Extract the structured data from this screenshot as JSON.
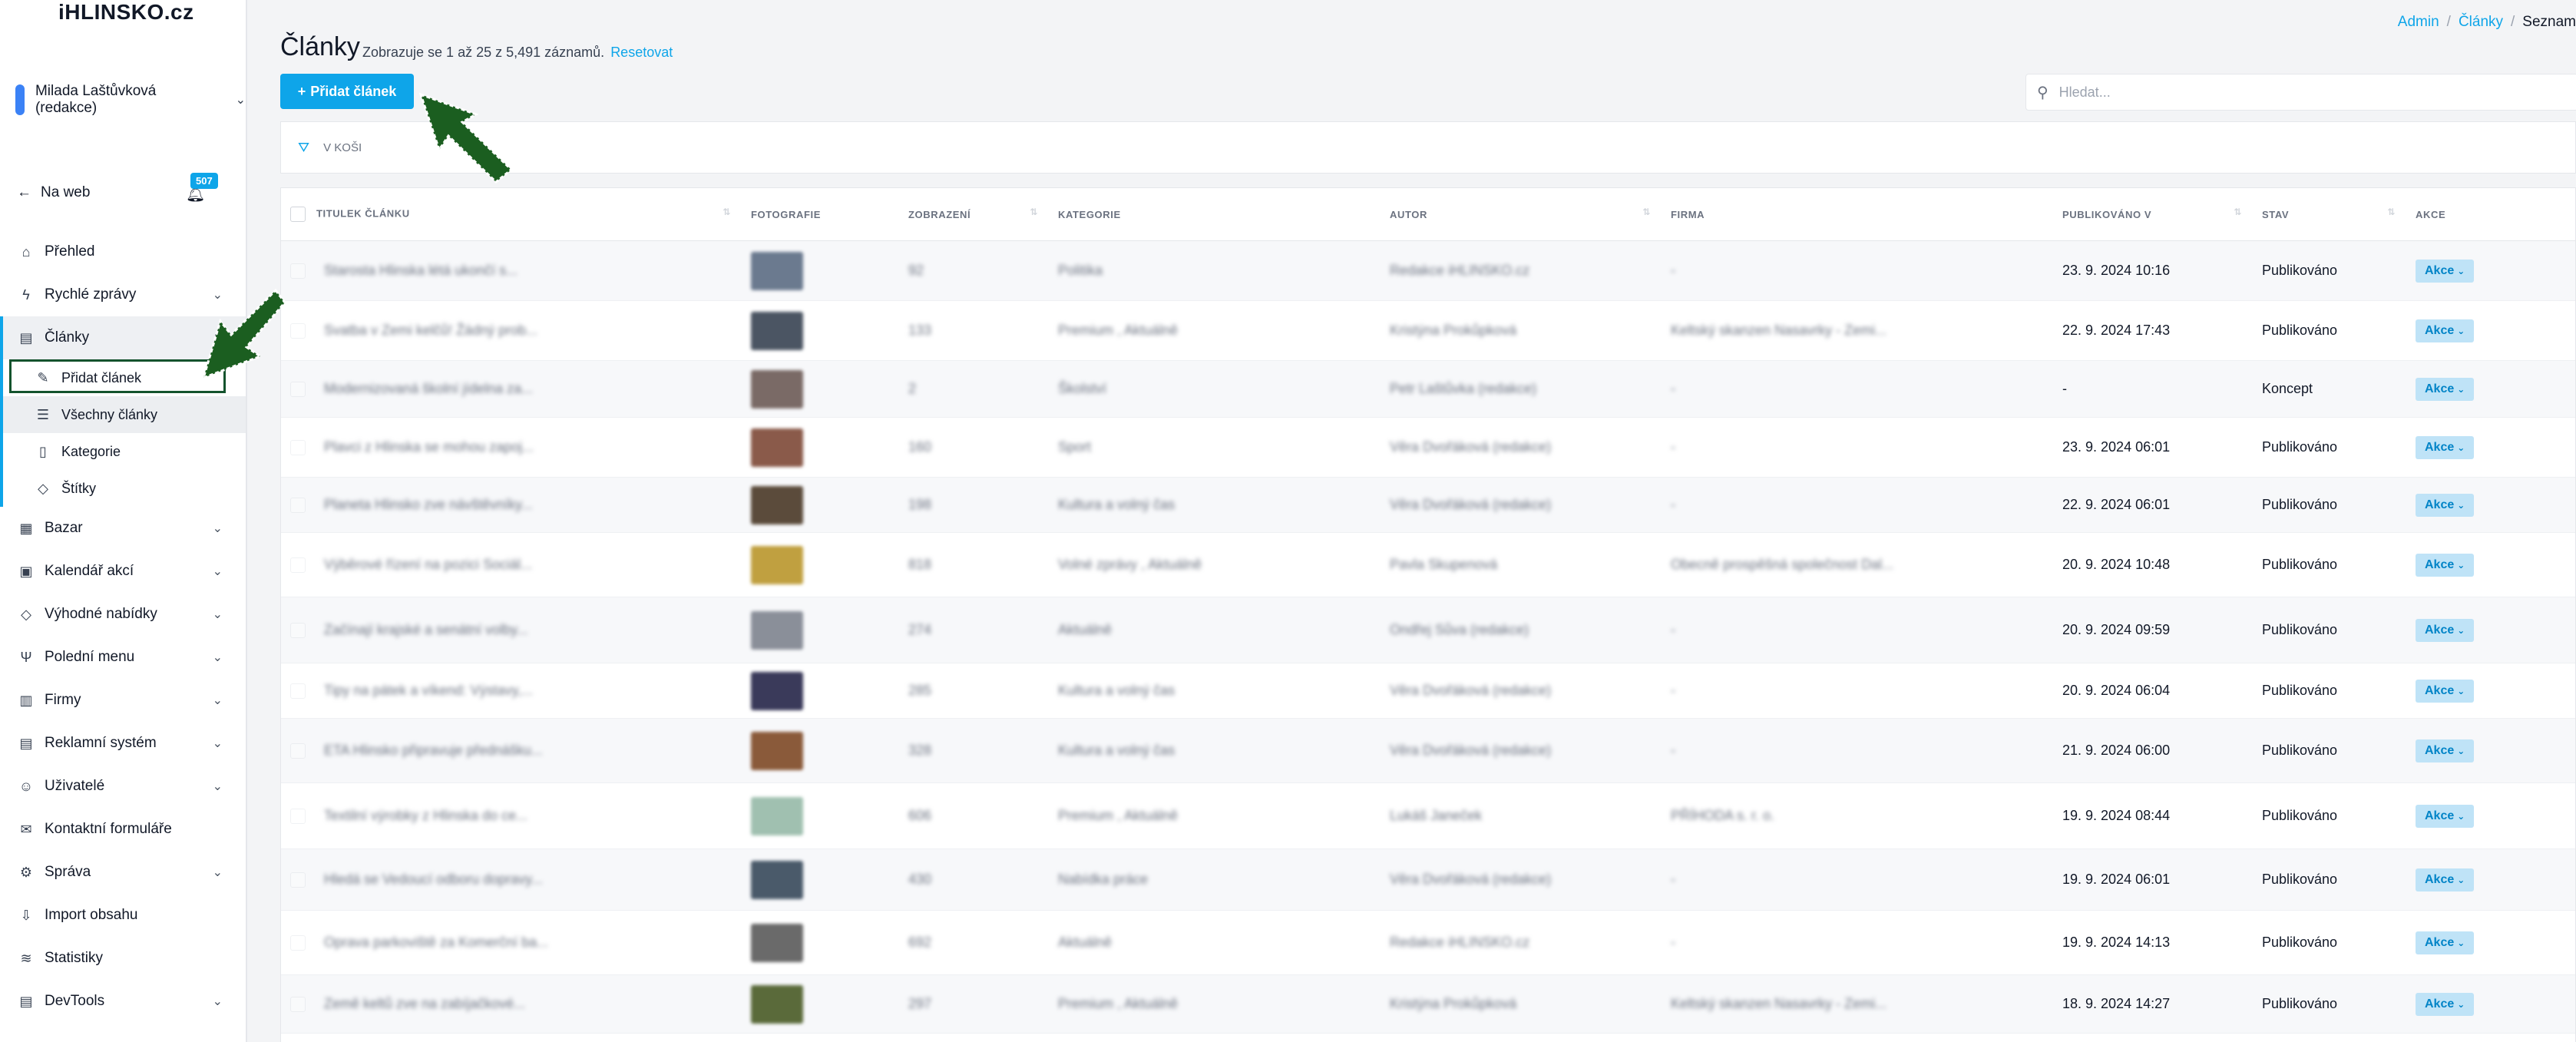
{
  "sidebar": {
    "logo": "iHLINSKO.cz",
    "user_name": "Milada Laštůvková (redakce)",
    "back_label": "Na web",
    "notifications_count": "507",
    "items": [
      {
        "label": "Přehled",
        "icon": "home-icon"
      },
      {
        "label": "Rychlé zprávy",
        "icon": "bolt-icon"
      },
      {
        "label": "Články",
        "icon": "newspaper-icon"
      },
      {
        "label": "Bazar",
        "icon": "store-icon"
      },
      {
        "label": "Kalendář akcí",
        "icon": "calendar-icon"
      },
      {
        "label": "Výhodné nabídky",
        "icon": "tag-icon"
      },
      {
        "label": "Polední menu",
        "icon": "utensils-icon"
      },
      {
        "label": "Firmy",
        "icon": "building-icon"
      },
      {
        "label": "Reklamní systém",
        "icon": "ad-icon"
      },
      {
        "label": "Uživatelé",
        "icon": "user-icon"
      },
      {
        "label": "Kontaktní formuláře",
        "icon": "mail-icon"
      },
      {
        "label": "Správa",
        "icon": "gear-icon"
      },
      {
        "label": "Import obsahu",
        "icon": "import-icon"
      },
      {
        "label": "Statistiky",
        "icon": "chart-icon"
      },
      {
        "label": "DevTools",
        "icon": "tools-icon"
      }
    ],
    "subitems": [
      {
        "label": "Přidat článek",
        "icon": "edit-icon"
      },
      {
        "label": "Všechny články",
        "icon": "list-icon"
      },
      {
        "label": "Kategorie",
        "icon": "bookmark-icon"
      },
      {
        "label": "Štítky",
        "icon": "tag-icon"
      }
    ]
  },
  "breadcrumb": [
    "Admin",
    "Články",
    "Seznam"
  ],
  "page": {
    "title": "Články",
    "info": "Zobrazuje se 1 až 25 z 5,491 záznamů.",
    "reset": "Resetovat",
    "add_button": "Přidat článek",
    "search_placeholder": "Hledat...",
    "filter_label": "V KOŠI"
  },
  "table": {
    "columns": [
      "TITULEK ČLÁNKU",
      "FOTOGRAFIE",
      "ZOBRAZENÍ",
      "KATEGORIE",
      "AUTOR",
      "FIRMA",
      "PUBLIKOVÁNO V",
      "STAV",
      "AKCE"
    ],
    "action_label": "Akce",
    "rows": [
      {
        "title": "Starosta Hlinska létá ukončí s...",
        "views": "92",
        "category": "Politika",
        "author": "Redakce iHLINSKO.cz",
        "company": "-",
        "published": "23. 9. 2024 10:16",
        "status": "Publikováno"
      },
      {
        "title": "Svatba v Zemi kelčů! Žádný prob...",
        "views": "133",
        "category": "Premium , Aktuálně",
        "author": "Kristýna Prokůpková",
        "company": "Keltský skanzen Nasavrky - Zemi...",
        "published": "22. 9. 2024 17:43",
        "status": "Publikováno"
      },
      {
        "title": "Modernizovaná školní jídelna za...",
        "views": "2",
        "category": "Školství",
        "author": "Petr Laštůvka (redakce)",
        "company": "-",
        "published": "-",
        "status": "Koncept"
      },
      {
        "title": "Plavci z Hlinska se mohou zapoj...",
        "views": "160",
        "category": "Sport",
        "author": "Věra Dvořáková (redakce)",
        "company": "-",
        "published": "23. 9. 2024 06:01",
        "status": "Publikováno"
      },
      {
        "title": "Planeta Hlinsko zve návštěvníky...",
        "views": "198",
        "category": "Kultura a volný čas",
        "author": "Věra Dvořáková (redakce)",
        "company": "-",
        "published": "22. 9. 2024 06:01",
        "status": "Publikováno"
      },
      {
        "title": "Výběrové řízení na pozici Sociál...",
        "views": "818",
        "category": "Volné zprávy , Aktuálně",
        "author": "Pavla Skupenová",
        "company": "Obecně prospěšná společnost Dal...",
        "published": "20. 9. 2024 10:48",
        "status": "Publikováno"
      },
      {
        "title": "Začínají krajské a senátní volby...",
        "views": "274",
        "category": "Aktuálně",
        "author": "Ondřej Sůva (redakce)",
        "company": "-",
        "published": "20. 9. 2024 09:59",
        "status": "Publikováno"
      },
      {
        "title": "Tipy na pátek a víkend: Výstavy,...",
        "views": "285",
        "category": "Kultura a volný čas",
        "author": "Věra Dvořáková (redakce)",
        "company": "-",
        "published": "20. 9. 2024 06:04",
        "status": "Publikováno"
      },
      {
        "title": "ETA Hlinsko připravuje přednášku...",
        "views": "328",
        "category": "Kultura a volný čas",
        "author": "Věra Dvořáková (redakce)",
        "company": "-",
        "published": "21. 9. 2024 06:00",
        "status": "Publikováno"
      },
      {
        "title": "Textilní výrobky z Hlinska do ce...",
        "views": "606",
        "category": "Premium , Aktuálně",
        "author": "Lukáš Janeček",
        "company": "PŘÍHODA s. r. o.",
        "published": "19. 9. 2024 08:44",
        "status": "Publikováno"
      },
      {
        "title": "Hledá se Vedoucí odboru dopravy...",
        "views": "430",
        "category": "Nabídka práce",
        "author": "Věra Dvořáková (redakce)",
        "company": "-",
        "published": "19. 9. 2024 06:01",
        "status": "Publikováno"
      },
      {
        "title": "Oprava parkoviště za Komerční ba...",
        "views": "692",
        "category": "Aktuálně",
        "author": "Redakce iHLINSKO.cz",
        "company": "-",
        "published": "19. 9. 2024 14:13",
        "status": "Publikováno"
      },
      {
        "title": "Země keltů zve na zabíjačkové...",
        "views": "297",
        "category": "Premium , Aktuálně",
        "author": "Kristýna Prokůpková",
        "company": "Keltský skanzen Nasavrky - Zemi...",
        "published": "18. 9. 2024 14:27",
        "status": "Publikováno"
      }
    ],
    "thumb_colors": [
      "#6b7a8f",
      "#4b5563",
      "#7a6a66",
      "#8a5a4a",
      "#5b4b3b",
      "#c0a040",
      "#8a8f99",
      "#3a3a5a",
      "#8a5a3a",
      "#a0c0b0",
      "#4a5a6a",
      "#6a6a6a",
      "#5a6a3a"
    ]
  },
  "colors": {
    "accent": "#0ea5e9",
    "annotation": "#14532d"
  }
}
